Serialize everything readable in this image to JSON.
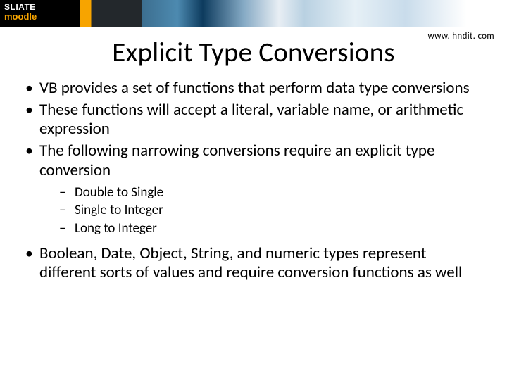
{
  "banner": {
    "logo_line1": "SLIATE",
    "logo_line2": "moodle"
  },
  "source_url": "www. hndit. com",
  "title": "Explicit Type Conversions",
  "bullets": [
    "VB provides a set of functions that perform data type conversions",
    "These functions will accept a literal, variable name, or arithmetic expression",
    "The following narrowing conversions require an explicit type conversion"
  ],
  "sub_bullets": [
    "Double to Single",
    "Single to Integer",
    "Long to Integer"
  ],
  "bullets_after": [
    "Boolean, Date, Object, String, and numeric types represent different sorts of values and require conversion functions as well"
  ]
}
